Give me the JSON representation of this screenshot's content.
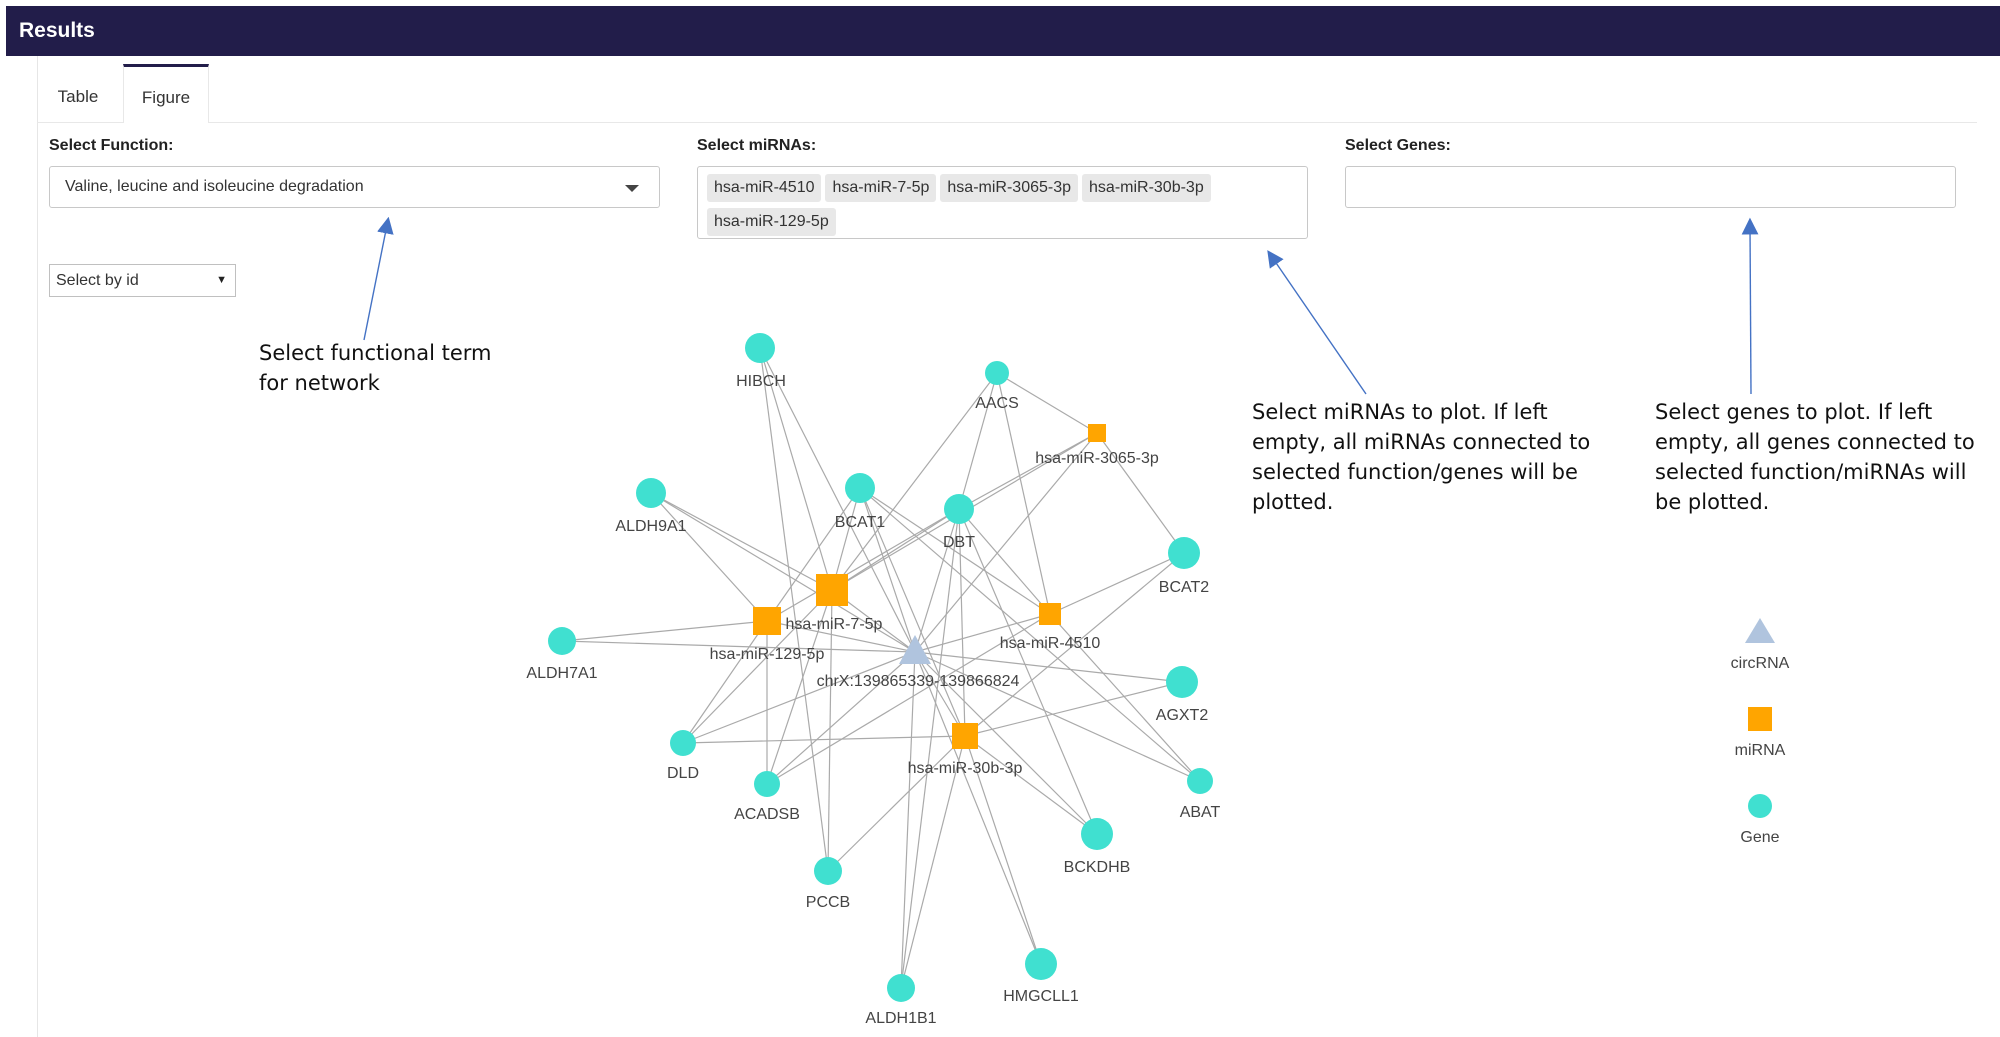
{
  "header": {
    "title": "Results"
  },
  "tabs": [
    {
      "label": "Table"
    },
    {
      "label": "Figure"
    }
  ],
  "controls": {
    "function": {
      "label": "Select Function:",
      "value": "Valine, leucine and isoleucine degradation"
    },
    "mirnas": {
      "label": "Select miRNAs:",
      "chips": [
        "hsa-miR-4510",
        "hsa-miR-7-5p",
        "hsa-miR-3065-3p",
        "hsa-miR-30b-3p",
        "hsa-miR-129-5p"
      ]
    },
    "genes": {
      "label": "Select Genes:",
      "value": ""
    },
    "select_by_id": {
      "value": "Select by id"
    }
  },
  "annotations": {
    "function": "Select functional term\nfor network",
    "mirnas": "Select miRNAs to plot. If left\nempty, all miRNAs connected to\nselected function/genes will be\nplotted.",
    "genes": "Select genes to plot. If left\nempty, all genes connected to\nselected function/miRNAs will\nbe plotted."
  },
  "colors": {
    "header": "#221d4a",
    "gene": "#40e0d0",
    "mirna": "#ffa500",
    "circrna": "#b0c4de",
    "edge": "#aaaaaa",
    "arrow": "#4472c4"
  },
  "network": {
    "circrna": {
      "label": "chrX:139865339-139866824"
    },
    "mirnas": [
      {
        "id": "hsa-miR-7-5p",
        "label": "hsa-miR-7-5p"
      },
      {
        "id": "hsa-miR-129-5p",
        "label": "hsa-miR-129-5p"
      },
      {
        "id": "hsa-miR-4510",
        "label": "hsa-miR-4510"
      },
      {
        "id": "hsa-miR-30b-3p",
        "label": "hsa-miR-30b-3p"
      },
      {
        "id": "hsa-miR-3065-3p",
        "label": "hsa-miR-3065-3p"
      }
    ],
    "genes": [
      {
        "id": "HIBCH",
        "label": "HIBCH"
      },
      {
        "id": "AACS",
        "label": "AACS"
      },
      {
        "id": "BCAT1",
        "label": "BCAT1"
      },
      {
        "id": "ALDH9A1",
        "label": "ALDH9A1"
      },
      {
        "id": "DBT",
        "label": "DBT"
      },
      {
        "id": "BCAT2",
        "label": "BCAT2"
      },
      {
        "id": "ALDH7A1",
        "label": "ALDH7A1"
      },
      {
        "id": "AGXT2",
        "label": "AGXT2"
      },
      {
        "id": "DLD",
        "label": "DLD"
      },
      {
        "id": "ACADSB",
        "label": "ACADSB"
      },
      {
        "id": "ABAT",
        "label": "ABAT"
      },
      {
        "id": "BCKDHB",
        "label": "BCKDHB"
      },
      {
        "id": "PCCB",
        "label": "PCCB"
      },
      {
        "id": "HMGCLL1",
        "label": "HMGCLL1"
      },
      {
        "id": "ALDH1B1",
        "label": "ALDH1B1"
      }
    ]
  },
  "legend": [
    {
      "shape": "triangle",
      "label": "circRNA"
    },
    {
      "shape": "square",
      "label": "miRNA"
    },
    {
      "shape": "circle",
      "label": "Gene"
    }
  ]
}
